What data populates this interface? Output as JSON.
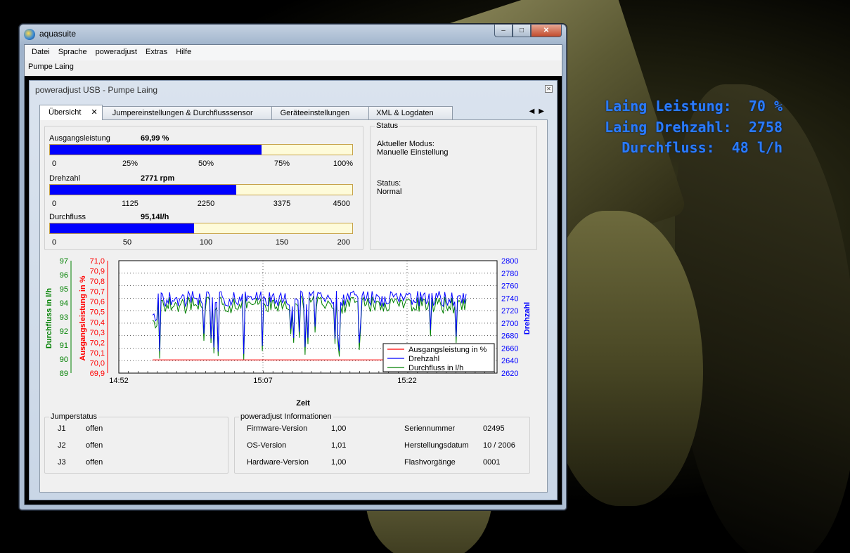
{
  "overlay": {
    "rows": [
      {
        "label": "Laing Leistung:",
        "value": "70 %"
      },
      {
        "label": "Laing Drehzahl:",
        "value": "2758"
      },
      {
        "label": "Durchfluss:",
        "value": "48 l/h"
      }
    ]
  },
  "window": {
    "title": "aquasuite",
    "caption_min": "–",
    "caption_max": "□",
    "caption_close": "✕",
    "menu": [
      "Datei",
      "Sprache",
      "poweradjust",
      "Extras",
      "Hilfe"
    ],
    "subtitle": "Pumpe Laing"
  },
  "child": {
    "title": "poweradjust USB - Pumpe Laing",
    "close_label": "✕",
    "tabs": [
      "Übersicht",
      "Jumpereinstellungen & Durchflusssensor",
      "Geräteeinstellungen",
      "XML & Logdaten"
    ],
    "tab_close": "✕",
    "tab_nav": "◀▶"
  },
  "gauges": [
    {
      "label": "Ausgangsleistung",
      "value": "69,99 %",
      "fraction": 0.6999,
      "scale": [
        "0",
        "25%",
        "50%",
        "75%",
        "100%"
      ]
    },
    {
      "label": "Drehzahl",
      "value": "2771 rpm",
      "fraction": 0.6158,
      "scale": [
        "0",
        "1125",
        "2250",
        "3375",
        "4500"
      ]
    },
    {
      "label": "Durchfluss",
      "value": "95,14l/h",
      "fraction": 0.4757,
      "scale": [
        "0",
        "50",
        "100",
        "150",
        "200"
      ]
    }
  ],
  "status": {
    "group_label": "Status",
    "mode_label": "Aktueller Modus:",
    "mode_value": "Manuelle Einstellung",
    "status_label": "Status:",
    "status_value": "Normal"
  },
  "chart_data": {
    "type": "line",
    "xlabel": "Zeit",
    "x_ticks": [
      "14:52",
      "15:07",
      "15:22"
    ],
    "axes": {
      "left_outer": {
        "label": "Durchfluss in l/h",
        "ticks": [
          "97",
          "96",
          "95",
          "94",
          "93",
          "92",
          "91",
          "90",
          "89"
        ],
        "range": [
          89,
          97
        ],
        "color": "#008000"
      },
      "left_inner": {
        "label": "Ausgangsleistung in %",
        "ticks": [
          "71,0",
          "70,9",
          "70,8",
          "70,7",
          "70,6",
          "70,5",
          "70,4",
          "70,3",
          "70,2",
          "70,1",
          "70,0",
          "69,9"
        ],
        "range": [
          69.9,
          71.0
        ],
        "color": "#ff0000"
      },
      "right": {
        "label": "Drehzahl",
        "ticks": [
          "2800",
          "2780",
          "2760",
          "2740",
          "2720",
          "2700",
          "2680",
          "2660",
          "2640",
          "2620"
        ],
        "range": [
          2620,
          2800
        ],
        "color": "#0000ff"
      }
    },
    "legend_position": "bottom-right",
    "grid": true,
    "series": [
      {
        "name": "Ausgangsleistung in %",
        "color": "#ff0000",
        "axis": "left_inner"
      },
      {
        "name": "Drehzahl",
        "color": "#0000ff",
        "axis": "right"
      },
      {
        "name": "Durchfluss in l/h",
        "color": "#008000",
        "axis": "left_outer"
      }
    ]
  },
  "jumper": {
    "group_label": "Jumperstatus",
    "rows": [
      {
        "name": "J1",
        "state": "offen"
      },
      {
        "name": "J2",
        "state": "offen"
      },
      {
        "name": "J3",
        "state": "offen"
      }
    ]
  },
  "info": {
    "group_label": "poweradjust Informationen",
    "left": [
      {
        "key": "Firmware-Version",
        "value": "1,00"
      },
      {
        "key": "OS-Version",
        "value": "1,01"
      },
      {
        "key": "Hardware-Version",
        "value": "1,00"
      }
    ],
    "right": [
      {
        "key": "Seriennummer",
        "value": "02495"
      },
      {
        "key": "Herstellungsdatum",
        "value": "10 / 2006"
      },
      {
        "key": "Flashvorgänge",
        "value": "0001"
      }
    ]
  }
}
